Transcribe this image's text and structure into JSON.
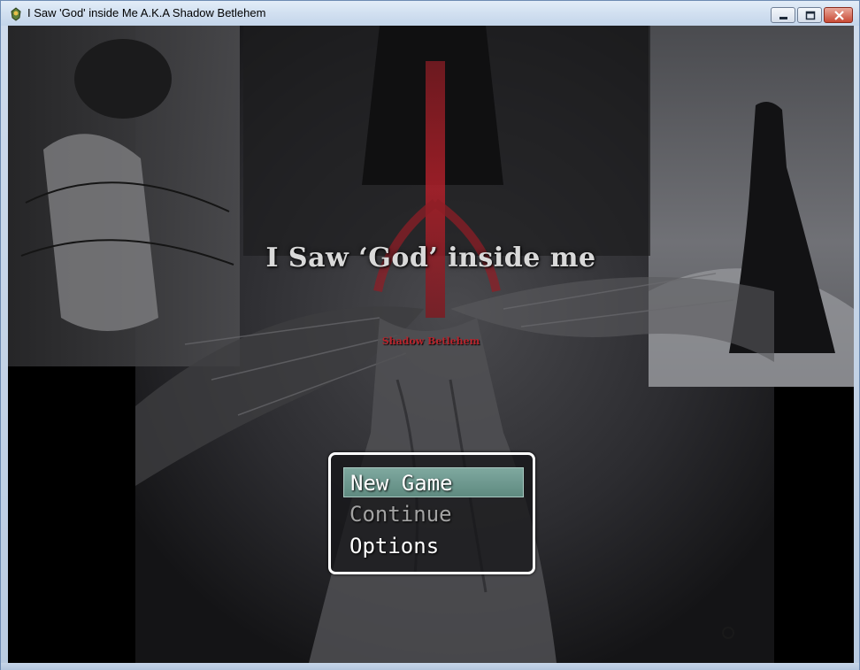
{
  "window": {
    "title": "I Saw 'God' inside Me A.K.A Shadow Betlehem",
    "icon": "game-app-icon",
    "controls": [
      "minimize-icon",
      "maximize-icon",
      "close-icon"
    ]
  },
  "title_screen": {
    "game_title": "I Saw ‘God’ inside me",
    "subtitle": "Shadow Betlehem"
  },
  "menu": {
    "selected_index": 0,
    "items": [
      {
        "label": "New Game",
        "state": "selected"
      },
      {
        "label": "Continue",
        "state": "disabled"
      },
      {
        "label": "Options",
        "state": "enabled"
      }
    ]
  },
  "colors": {
    "menu_highlight": "#6f988f",
    "menu_border": "#ffffff",
    "subtitle": "#b8242c",
    "cross": "#b0202a",
    "close_button": "#c84a35"
  }
}
